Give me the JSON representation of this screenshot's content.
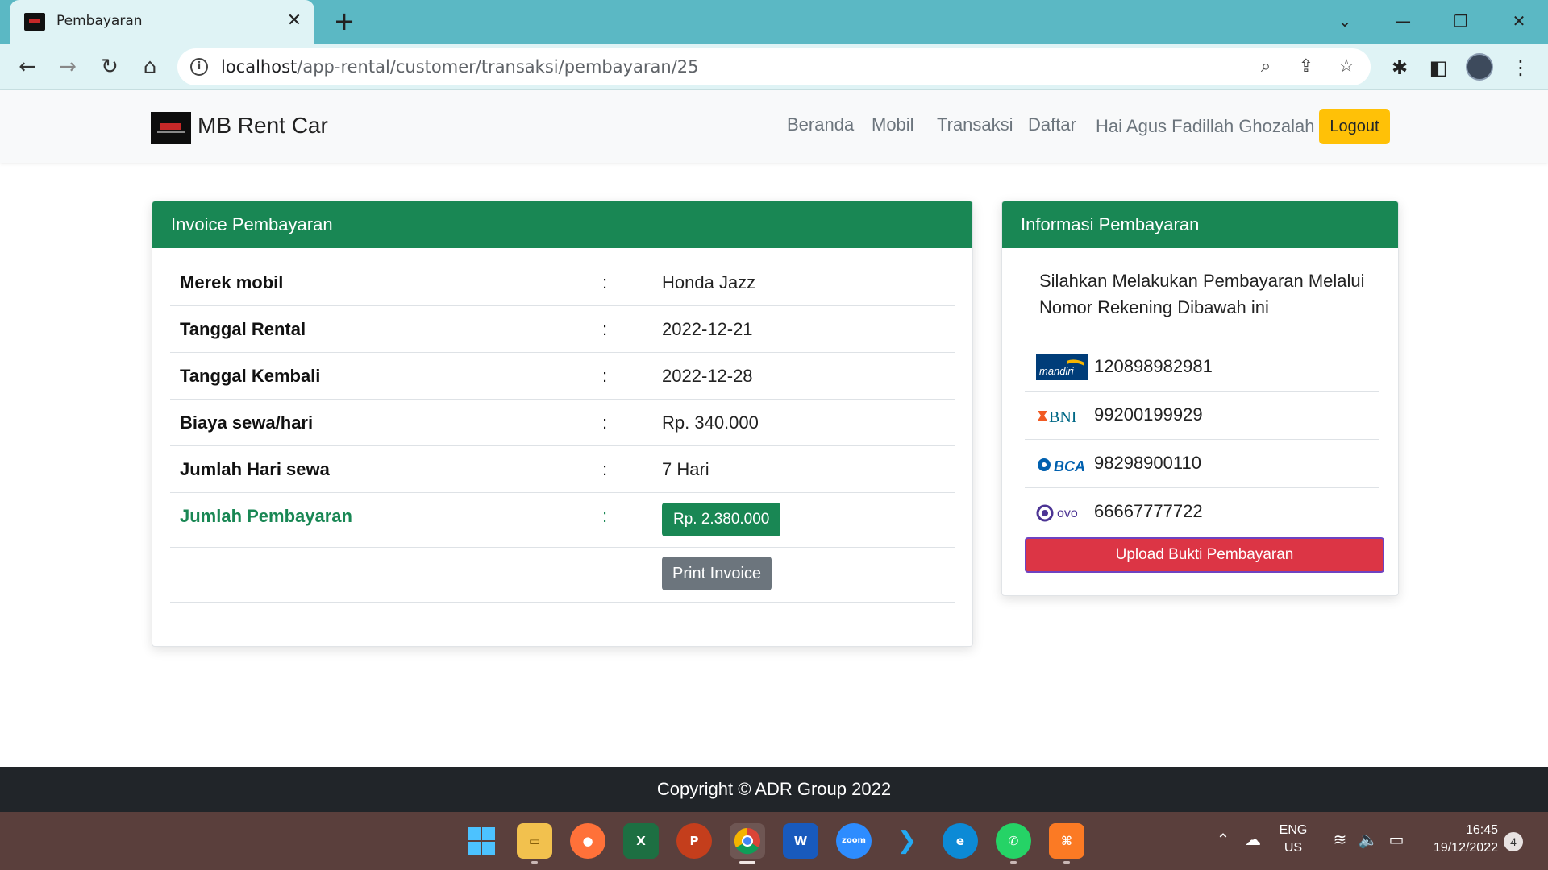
{
  "browser": {
    "tab_title": "Pembayaran",
    "tab_close": "✕",
    "new_tab": "+",
    "url_host": "localhost",
    "url_path": "/app-rental/customer/transaksi/pembayaran/25",
    "window_controls": {
      "dropdown": "⌄",
      "minimize": "—",
      "restore": "❐",
      "close": "✕"
    }
  },
  "site": {
    "brand": "MB Rent Car",
    "nav": [
      "Beranda",
      "Mobil",
      "Transaksi",
      "Daftar"
    ],
    "greeting": "Hai Agus Fadillah Ghozalah",
    "logout": "Logout"
  },
  "invoice": {
    "header": "Invoice Pembayaran",
    "rows": [
      {
        "label": "Merek mobil",
        "colon": ":",
        "value": "Honda Jazz"
      },
      {
        "label": "Tanggal Rental",
        "colon": ":",
        "value": "2022-12-21"
      },
      {
        "label": "Tanggal Kembali",
        "colon": ":",
        "value": "2022-12-28"
      },
      {
        "label": "Biaya sewa/hari",
        "colon": ":",
        "value": "Rp. 340.000"
      },
      {
        "label": "Jumlah Hari sewa",
        "colon": ":",
        "value": "7 Hari"
      }
    ],
    "total_label": "Jumlah Pembayaran",
    "total_colon": ":",
    "total_value": "Rp. 2.380.000",
    "print_button": "Print Invoice"
  },
  "payment": {
    "header": "Informasi Pembayaran",
    "intro": "Silahkan Melakukan Pembayaran Melalui Nomor Rekening Dibawah ini",
    "banks": [
      {
        "logo_text": "mandiri",
        "number": "120898982981",
        "color": "#003d79"
      },
      {
        "logo_text": "BNI",
        "number": "99200199929",
        "color": "#f15a23"
      },
      {
        "logo_text": "BCA",
        "number": "98298900110",
        "color": "#0060af"
      },
      {
        "logo_text": "ovo",
        "number": "66667777722",
        "color": "#4c3494"
      }
    ],
    "upload_button": "Upload Bukti Pembayaran"
  },
  "footer": {
    "copyright": "Copyright © ADR Group 2022"
  },
  "taskbar": {
    "lang": "ENG",
    "region": "US",
    "time": "16:45",
    "date": "19/12/2022",
    "notifications": "4"
  },
  "colors": {
    "primary_green": "#198754",
    "logout_yellow": "#ffc107",
    "upload_red": "#dc3545",
    "print_gray": "#6c757d",
    "tabbar": "#5bb8c4",
    "footer": "#212529"
  }
}
